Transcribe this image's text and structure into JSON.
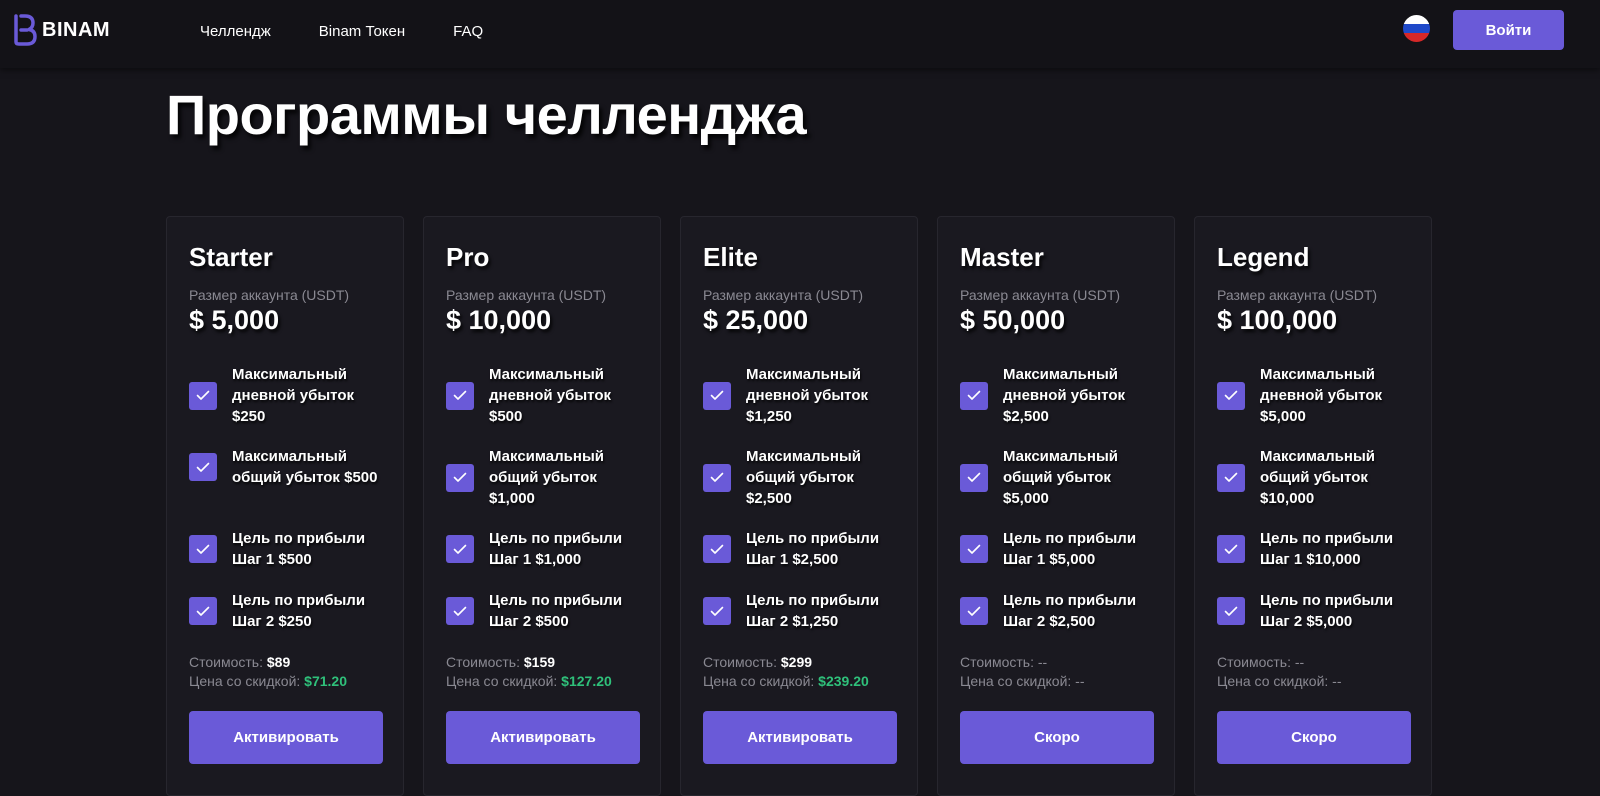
{
  "header": {
    "logo_text": "BINAM",
    "nav": [
      "Челлендж",
      "Binam Токен",
      "FAQ"
    ],
    "language_flag": "russia-flag-icon",
    "login_label": "Войти"
  },
  "page_title": "Программы челленджа",
  "colors": {
    "accent": "#6a5ad8",
    "background": "#16151b",
    "card": "#1a1920",
    "discount": "#2fc07a",
    "muted": "#8a8992"
  },
  "size_label": "Размер аккаунта (USDT)",
  "cost_label": "Стоимость: ",
  "discount_label": "Цена со скидкой: ",
  "cards": [
    {
      "name": "Starter",
      "size": "$ 5,000",
      "features": [
        "Максимальный дневной убыток $250",
        "Максимальный общий убыток $500",
        "Цель по прибыли Шаг 1 $500",
        "Цель по прибыли Шаг 2 $250"
      ],
      "cost": "$89",
      "discount_price": "$71.20",
      "button": "Активировать"
    },
    {
      "name": "Pro",
      "size": "$ 10,000",
      "features": [
        "Максимальный дневной убыток $500",
        "Максимальный общий убыток $1,000",
        "Цель по прибыли Шаг 1 $1,000",
        "Цель по прибыли Шаг 2 $500"
      ],
      "cost": "$159",
      "discount_price": "$127.20",
      "button": "Активировать"
    },
    {
      "name": "Elite",
      "size": "$ 25,000",
      "features": [
        "Максимальный дневной убыток $1,250",
        "Максимальный общий убыток $2,500",
        "Цель по прибыли Шаг 1 $2,500",
        "Цель по прибыли Шаг 2 $1,250"
      ],
      "cost": "$299",
      "discount_price": "$239.20",
      "button": "Активировать"
    },
    {
      "name": "Master",
      "size": "$ 50,000",
      "features": [
        "Максимальный дневной убыток $2,500",
        "Максимальный общий убыток $5,000",
        "Цель по прибыли Шаг 1 $5,000",
        "Цель по прибыли Шаг 2 $2,500"
      ],
      "cost": "--",
      "discount_price": "--",
      "button": "Скоро"
    },
    {
      "name": "Legend",
      "size": "$ 100,000",
      "features": [
        "Максимальный дневной убыток $5,000",
        "Максимальный общий убыток $10,000",
        "Цель по прибыли Шаг 1 $10,000",
        "Цель по прибыли Шаг 2 $5,000"
      ],
      "cost": "--",
      "discount_price": "--",
      "button": "Скоро"
    }
  ]
}
